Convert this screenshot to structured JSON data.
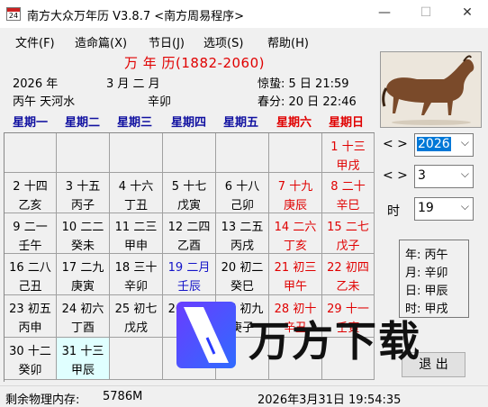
{
  "window": {
    "app_icon_text": "24",
    "title": "南方大众万年历  V3.8.7   <南方周易程序>",
    "minimize": "—",
    "maximize": "☐",
    "close": "✕"
  },
  "menu": [
    "文件(F)",
    "造命篇(X)",
    "节日(J)",
    "选项(S)",
    "帮助(H)"
  ],
  "header": {
    "app_heading": "万  年  历(1882-2060)",
    "year_line": "2026 年",
    "month_line": "3   月   二 月",
    "jieqi1": "惊蛰:  5  日  21:59",
    "ganzhi_year": "丙午  天河水",
    "ganzhi_month": "辛卯",
    "jieqi2": "春分:  20  日  22:46"
  },
  "weekdays": [
    "星期一",
    "星期二",
    "星期三",
    "星期四",
    "星期五",
    "星期六",
    "星期日"
  ],
  "calendar": {
    "rows": [
      [
        null,
        null,
        null,
        null,
        null,
        null,
        {
          "d1": "1  十三",
          "d2": "甲戌",
          "style": "red"
        }
      ],
      [
        {
          "d1": "2  十四",
          "d2": "乙亥"
        },
        {
          "d1": "3  十五",
          "d2": "丙子"
        },
        {
          "d1": "4  十六",
          "d2": "丁丑"
        },
        {
          "d1": "5  十七",
          "d2": "戊寅"
        },
        {
          "d1": "6  十八",
          "d2": "己卯"
        },
        {
          "d1": "7  十九",
          "d2": "庚辰",
          "style": "red"
        },
        {
          "d1": "8  二十",
          "d2": "辛巳",
          "style": "red"
        }
      ],
      [
        {
          "d1": "9  二一",
          "d2": "壬午"
        },
        {
          "d1": "10 二二",
          "d2": "癸未"
        },
        {
          "d1": "11 二三",
          "d2": "甲申"
        },
        {
          "d1": "12 二四",
          "d2": "乙酉"
        },
        {
          "d1": "13 二五",
          "d2": "丙戌"
        },
        {
          "d1": "14 二六",
          "d2": "丁亥",
          "style": "red"
        },
        {
          "d1": "15 二七",
          "d2": "戊子",
          "style": "red"
        }
      ],
      [
        {
          "d1": "16 二八",
          "d2": "己丑"
        },
        {
          "d1": "17 二九",
          "d2": "庚寅"
        },
        {
          "d1": "18 三十",
          "d2": "辛卯"
        },
        {
          "d1": "19 二月",
          "d2": "壬辰",
          "style": "blue"
        },
        {
          "d1": "20 初二",
          "d2": "癸巳"
        },
        {
          "d1": "21 初三",
          "d2": "甲午",
          "style": "red"
        },
        {
          "d1": "22 初四",
          "d2": "乙未",
          "style": "red"
        }
      ],
      [
        {
          "d1": "23 初五",
          "d2": "丙申"
        },
        {
          "d1": "24 初六",
          "d2": "丁酉"
        },
        {
          "d1": "25 初七",
          "d2": "戊戌"
        },
        {
          "d1": "26 初八",
          "d2": "己亥"
        },
        {
          "d1": "27 初九",
          "d2": "庚子"
        },
        {
          "d1": "28 初十",
          "d2": "辛丑",
          "style": "red"
        },
        {
          "d1": "29 十一",
          "d2": "壬寅",
          "style": "red"
        }
      ],
      [
        {
          "d1": "30 十二",
          "d2": "癸卯"
        },
        {
          "d1": "31 十三",
          "d2": "甲辰",
          "style": "today"
        },
        null,
        null,
        null,
        null,
        null
      ]
    ]
  },
  "controls": {
    "nav_year": "<  >",
    "nav_month": "<  >",
    "hour_label": "时",
    "year_value": "2026",
    "month_value": "3",
    "hour_value": "19",
    "dropdown_arrow": "⌵",
    "ganzhi": {
      "year": "年:  丙午",
      "month": "月:  辛卯",
      "day": "日:  甲辰",
      "hour": "时:  甲戌"
    },
    "exit_label": "退 出"
  },
  "status": {
    "memory_label": "剩余物理内存:",
    "memory_value": "5786M",
    "datetime": "2026年3月31日 19:54:35"
  },
  "watermark": {
    "text": "万方下载"
  },
  "colors": {
    "red": "#e00000",
    "blue_header": "#1010a0",
    "today_bg": "#e0ffff",
    "select_highlight": "#0078d7"
  }
}
